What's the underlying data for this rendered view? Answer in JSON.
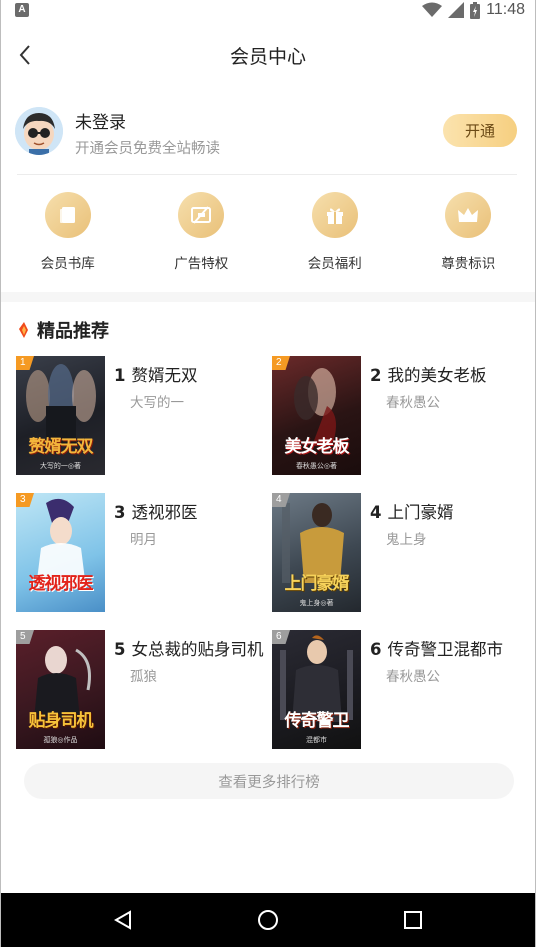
{
  "status_bar": {
    "time": "11:48",
    "left_badge": "A"
  },
  "header": {
    "title": "会员中心",
    "back_icon": "chevron-left-icon"
  },
  "user": {
    "name": "未登录",
    "subtitle": "开通会员免费全站畅读",
    "open_button": "开通"
  },
  "privileges": [
    {
      "label": "会员书库",
      "icon": "book-icon"
    },
    {
      "label": "广告特权",
      "icon": "no-ads-icon"
    },
    {
      "label": "会员福利",
      "icon": "gift-icon"
    },
    {
      "label": "尊贵标识",
      "icon": "crown-icon"
    }
  ],
  "section": {
    "title": "精品推荐"
  },
  "books": [
    {
      "rank": "1",
      "num": "1",
      "title": "赘婿无双",
      "author": "大写的一",
      "cover_text": "赘婿无双",
      "cover_author": "大写的一◎著",
      "tag_color": "#f59a23"
    },
    {
      "rank": "2",
      "num": "2",
      "title": "我的美女老板",
      "author": "春秋愚公",
      "cover_text": "美女老板",
      "cover_author": "春秋愚公◎著",
      "tag_color": "#f59a23"
    },
    {
      "rank": "3",
      "num": "3",
      "title": "透视邪医",
      "author": "明月",
      "cover_text": "透视邪医",
      "cover_author": "",
      "tag_color": "#f59a23"
    },
    {
      "rank": "4",
      "num": "4",
      "title": "上门豪婿",
      "author": "鬼上身",
      "cover_text": "上门豪婿",
      "cover_author": "鬼上身◎著",
      "tag_color": "#9e9e9e"
    },
    {
      "rank": "5",
      "num": "5",
      "title": "女总裁的贴身司机",
      "author": "孤狼",
      "cover_text": "贴身司机",
      "cover_author": "孤狼◎作品",
      "tag_color": "#9e9e9e"
    },
    {
      "rank": "6",
      "num": "6",
      "title": "传奇警卫混都市",
      "author": "春秋愚公",
      "cover_text": "传奇警卫",
      "cover_author": "混都市",
      "tag_color": "#9e9e9e"
    }
  ],
  "more_button": "查看更多排行榜",
  "nav": {
    "back": "nav-back-icon",
    "home": "nav-home-icon",
    "recents": "nav-recents-icon"
  }
}
